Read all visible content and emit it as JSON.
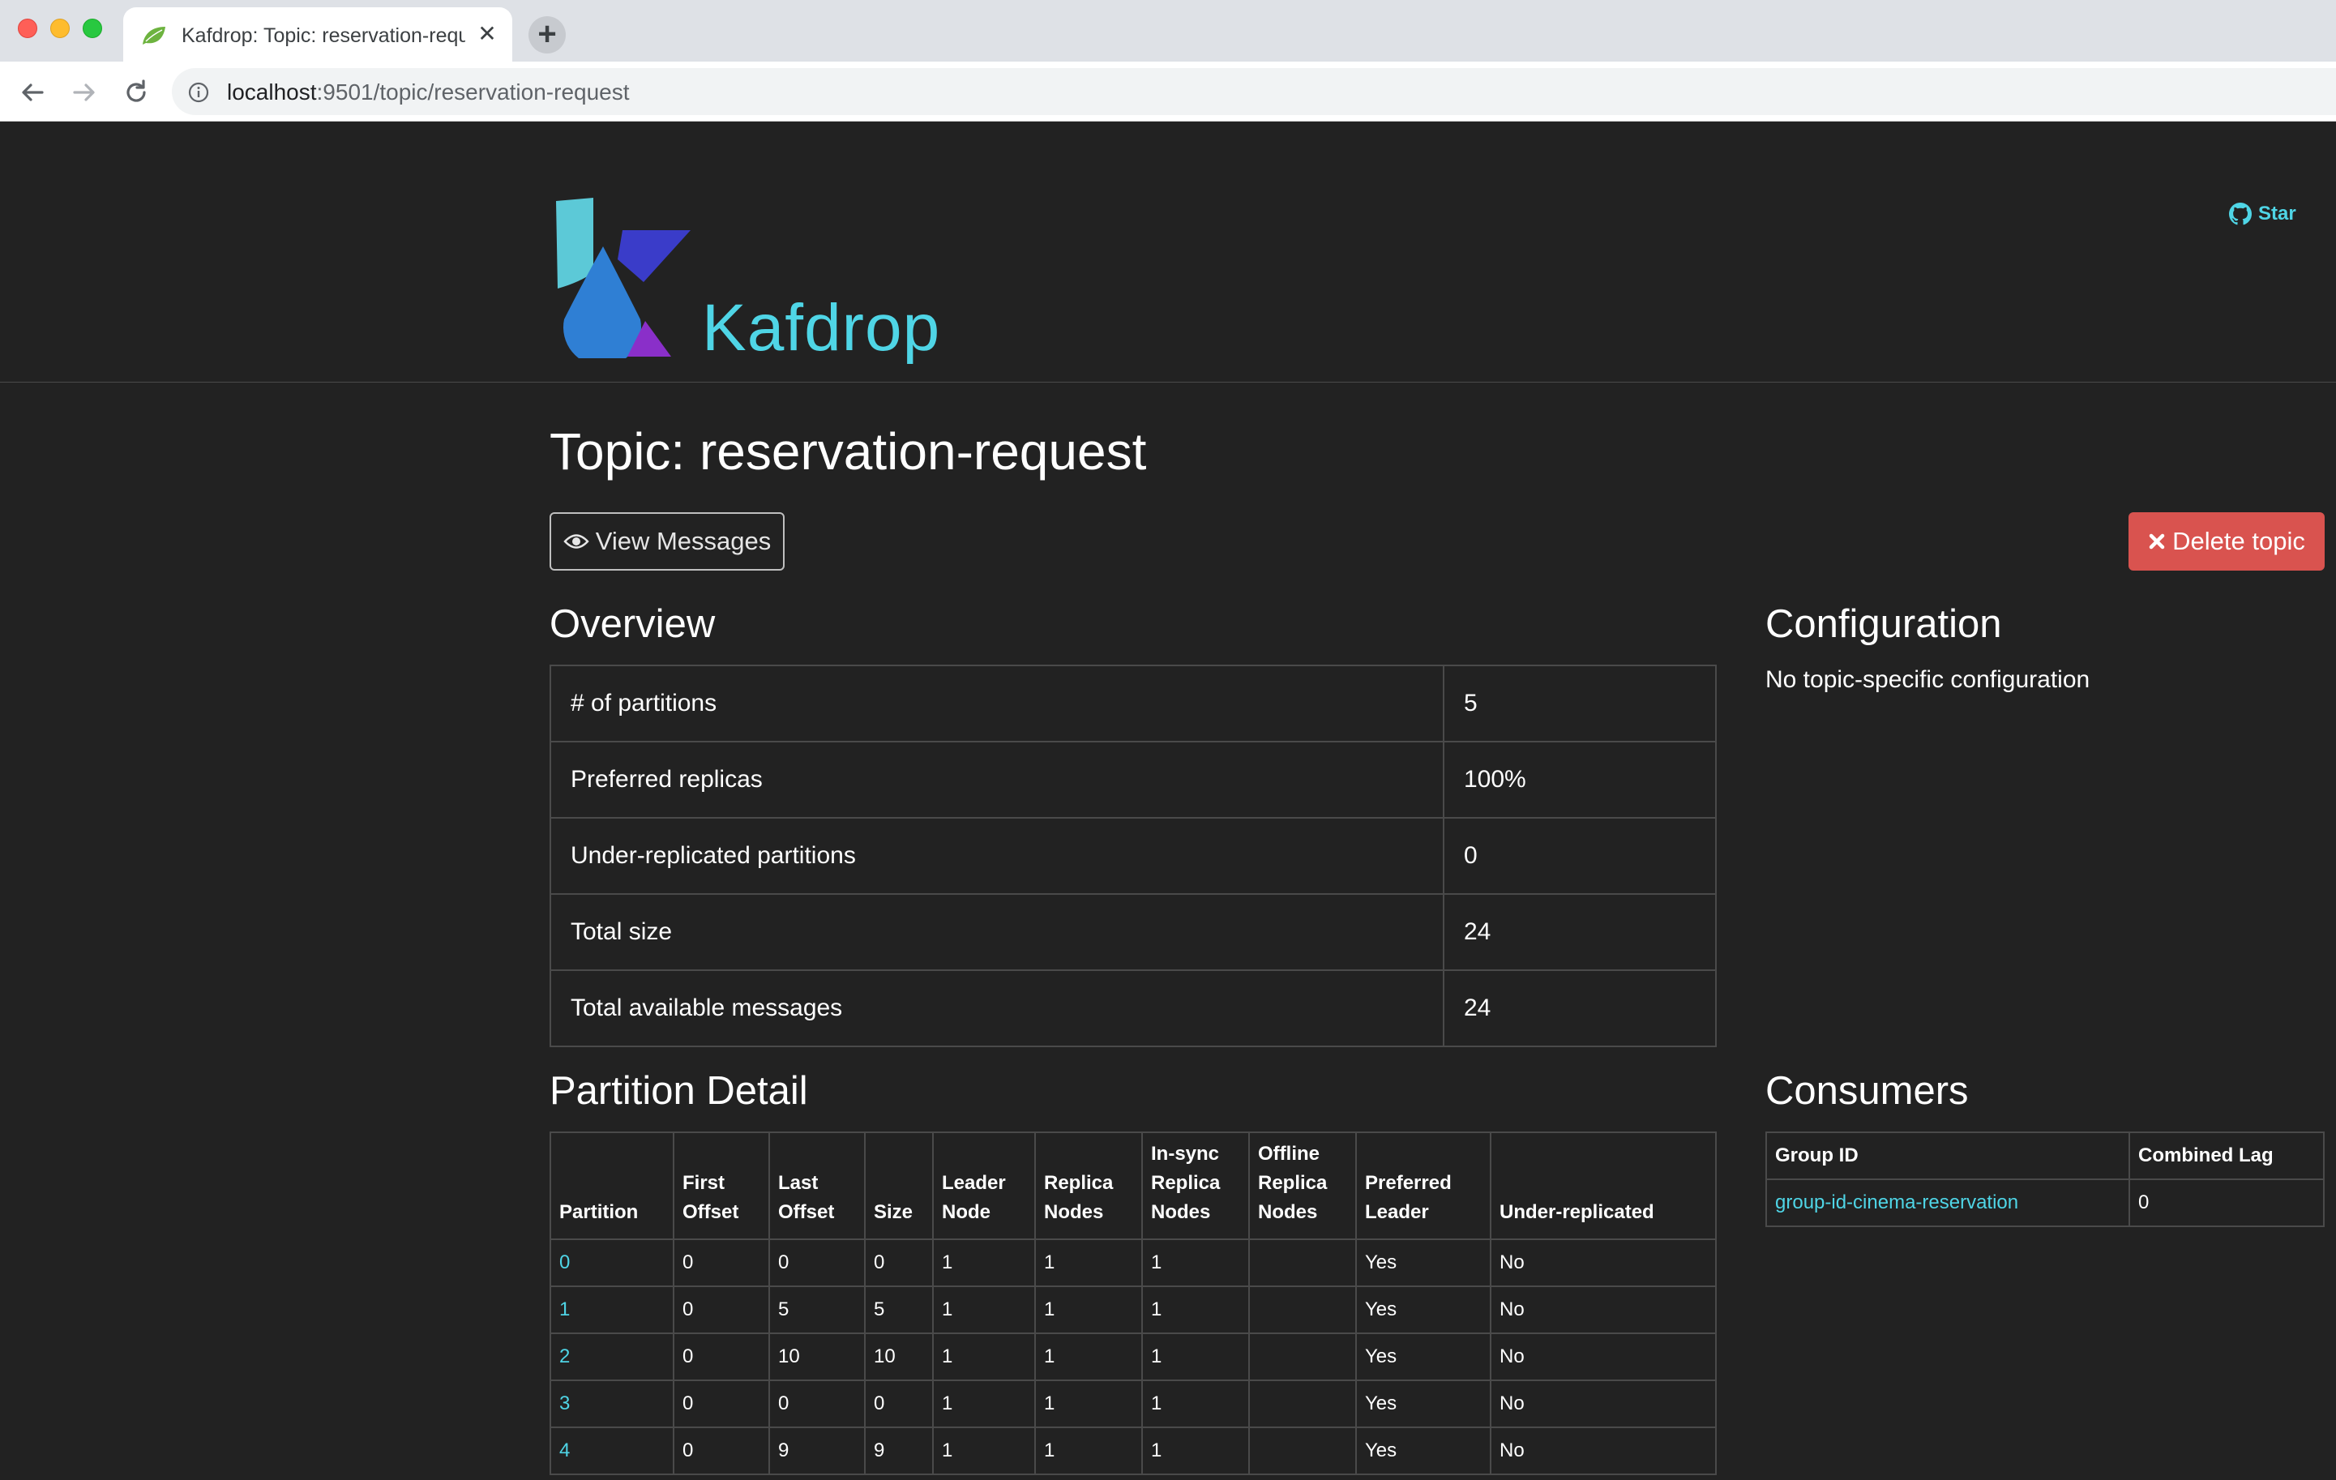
{
  "browser": {
    "tab_title": "Kafdrop: Topic: reservation-request",
    "url_host": "localhost",
    "url_rest": ":9501/topic/reservation-request",
    "new_tab_label": "+",
    "close_glyph": "✕"
  },
  "header": {
    "brand": "Kafdrop",
    "github_star": "Star",
    "colors": {
      "brand": "#4fd5e6",
      "background": "#222222"
    }
  },
  "topic": {
    "title": "Topic: reservation-request",
    "view_messages": "View Messages",
    "delete_topic": "Delete topic",
    "delete_color": "#d9534f"
  },
  "overview": {
    "heading": "Overview",
    "rows": [
      {
        "label": "# of partitions",
        "value": "5"
      },
      {
        "label": "Preferred replicas",
        "value": "100%"
      },
      {
        "label": "Under-replicated partitions",
        "value": "0"
      },
      {
        "label": "Total size",
        "value": "24"
      },
      {
        "label": "Total available messages",
        "value": "24"
      }
    ]
  },
  "configuration": {
    "heading": "Configuration",
    "text": "No topic-specific configuration"
  },
  "partition_detail": {
    "heading": "Partition Detail",
    "columns": [
      "Partition",
      "First Offset",
      "Last Offset",
      "Size",
      "Leader Node",
      "Replica Nodes",
      "In-sync Replica Nodes",
      "Offline Replica Nodes",
      "Preferred Leader",
      "Under-replicated"
    ],
    "rows": [
      [
        "0",
        "0",
        "0",
        "0",
        "1",
        "1",
        "1",
        "",
        "Yes",
        "No"
      ],
      [
        "1",
        "0",
        "5",
        "5",
        "1",
        "1",
        "1",
        "",
        "Yes",
        "No"
      ],
      [
        "2",
        "0",
        "10",
        "10",
        "1",
        "1",
        "1",
        "",
        "Yes",
        "No"
      ],
      [
        "3",
        "0",
        "0",
        "0",
        "1",
        "1",
        "1",
        "",
        "Yes",
        "No"
      ],
      [
        "4",
        "0",
        "9",
        "9",
        "1",
        "1",
        "1",
        "",
        "Yes",
        "No"
      ]
    ]
  },
  "consumers": {
    "heading": "Consumers",
    "columns": [
      "Group ID",
      "Combined Lag"
    ],
    "rows": [
      [
        "group-id-cinema-reservation",
        "0"
      ]
    ]
  }
}
